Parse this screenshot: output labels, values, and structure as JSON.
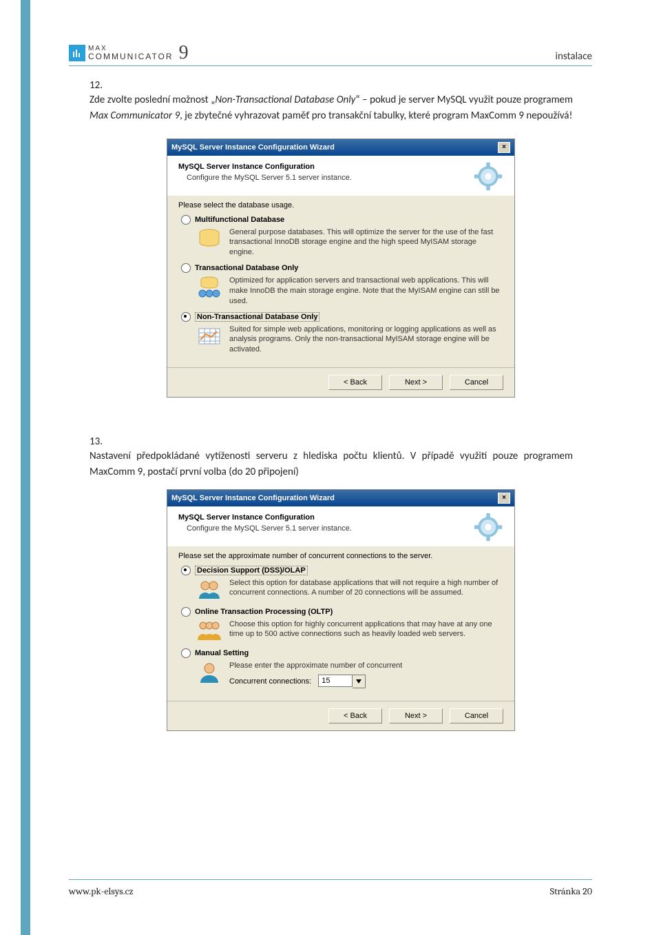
{
  "header": {
    "logo_line1": "MAX",
    "logo_line2": "COMMUNICATOR",
    "logo_suffix": "9",
    "right": "instalace"
  },
  "item12": {
    "num": "12.",
    "t1": "Zde zvolte poslední možnost „",
    "t2": "Non-Transactional Database Only",
    "t3": "“ – pokud je server MySQL využit pouze programem ",
    "t4": "Max Communicator 9",
    "t5": ", je zbytečné vyhrazovat paměť pro transakční tabulky, které program MaxComm 9 nepoužívá!"
  },
  "dlg1": {
    "title": "MySQL Server Instance Configuration Wizard",
    "close": "×",
    "banner_title": "MySQL Server Instance Configuration",
    "banner_sub": "Configure the MySQL Server 5.1 server instance.",
    "lead": "Please select the database usage.",
    "opt1_label": "Multifunctional Database",
    "opt1_desc": "General purpose databases. This will optimize the server for the use of the fast transactional InnoDB storage engine and the high speed MyISAM storage engine.",
    "opt2_label": "Transactional Database Only",
    "opt2_desc": "Optimized for application servers and transactional web applications. This will make InnoDB the main storage engine. Note that the MyISAM engine can still be used.",
    "opt3_label": "Non-Transactional Database Only",
    "opt3_desc": "Suited for simple web applications, monitoring or logging applications as well as analysis programs. Only the non-transactional MyISAM storage engine will be activated.",
    "back": "< Back",
    "next": "Next >",
    "cancel": "Cancel"
  },
  "item13": {
    "num": "13.",
    "text": "Nastavení předpokládané vytíženosti serveru z hlediska počtu klientů. V případě využití pouze programem MaxComm 9, postačí první volba (do 20 připojení)"
  },
  "dlg2": {
    "title": "MySQL Server Instance Configuration Wizard",
    "close": "×",
    "banner_title": "MySQL Server Instance Configuration",
    "banner_sub": "Configure the MySQL Server 5.1 server instance.",
    "lead": "Please set the approximate number of concurrent connections to the server.",
    "opt1_label": "Decision Support (DSS)/OLAP",
    "opt1_desc": "Select this option for database applications that will not require a high number of concurrent connections. A number of 20 connections will be assumed.",
    "opt2_label": "Online Transaction Processing (OLTP)",
    "opt2_desc": "Choose this option for highly concurrent applications that may have at any one time up to 500 active connections such as heavily loaded web servers.",
    "opt3_label": "Manual Setting",
    "opt3_desc": "Please enter the approximate number of concurrent",
    "cc_label": "Concurrent connections:",
    "cc_value": "15",
    "back": "< Back",
    "next": "Next >",
    "cancel": "Cancel"
  },
  "footer": {
    "left": "www.pk-elsys.cz",
    "right": "Stránka 20"
  }
}
